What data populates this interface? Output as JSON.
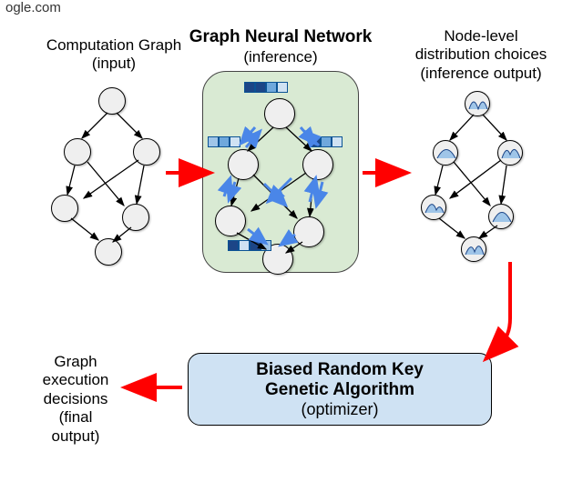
{
  "header_fragment": "ogle.com",
  "labels": {
    "input_l1": "Computation Graph",
    "input_l2": "(input)",
    "center_l1": "Graph Neural Network",
    "center_l2": "(inference)",
    "right_l1": "Node-level",
    "right_l2": "distribution choices",
    "right_l3": "(inference output)",
    "final_l1": "Graph",
    "final_l2": "execution",
    "final_l3": "decisions",
    "final_l4": "(final output)"
  },
  "optimizer": {
    "line1": "Biased Random Key",
    "line2": "Genetic Algorithm",
    "line3": "(optimizer)"
  },
  "feature_bars": {
    "a": [
      "#1c4587",
      "#1c4587",
      "#6fa8dc",
      "#cfe2f3"
    ],
    "b": [
      "#9fc5e8",
      "#6fa8dc",
      "#cfe2f3"
    ],
    "c": [
      "#1c4587",
      "#6fa8dc",
      "#cfe2f3"
    ],
    "d": [
      "#1c4587",
      "#cfe2f3",
      "#1c4587",
      "#9fc5e8"
    ]
  }
}
